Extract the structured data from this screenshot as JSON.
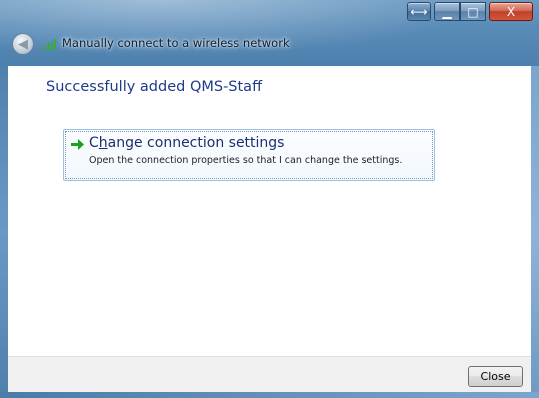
{
  "window": {
    "title": "Manually connect to a wireless network",
    "caption_buttons": {
      "resize": "⟷",
      "minimize": "▁",
      "maximize": "□",
      "close": "X"
    }
  },
  "main": {
    "heading": "Successfully added QMS-Staff",
    "option": {
      "title_before": "C",
      "title_access_key": "h",
      "title_after": "ange connection settings",
      "description": "Open the connection properties so that I can change the settings.",
      "icon": "green-arrow-icon"
    }
  },
  "footer": {
    "close_label": "Close"
  },
  "colors": {
    "heading": "#1e3a8a",
    "arrow": "#1aa31a",
    "titlebar": "#5a8cb8"
  }
}
